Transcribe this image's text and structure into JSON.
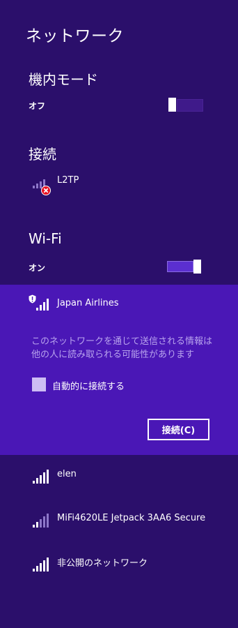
{
  "panel": {
    "title": "ネットワーク"
  },
  "airplane": {
    "header": "機内モード",
    "state": "オフ"
  },
  "connections": {
    "header": "接続",
    "items": [
      {
        "name": "L2TP",
        "icon": "signal-error-icon"
      }
    ]
  },
  "wifi": {
    "header": "Wi-Fi",
    "state": "オン",
    "selected": {
      "name": "Japan Airlines",
      "icon": "signal-warning-icon",
      "warning": "このネットワークを通じて送信される情報は他の人に読み取られる可能性があります",
      "auto_connect_label": "自動的に接続する",
      "connect_button": "接続(C)"
    },
    "networks": [
      {
        "name": "elen",
        "icon": "signal-full-icon"
      },
      {
        "name": "MiFi4620LE Jetpack 3AA6 Secure",
        "icon": "signal-partial-icon"
      },
      {
        "name": "非公開のネットワーク",
        "icon": "signal-full-icon"
      }
    ]
  },
  "colors": {
    "background": "#2b0f6b",
    "selected": "#4a17b6",
    "accent": "#5b2fd0",
    "error": "#e81123"
  }
}
